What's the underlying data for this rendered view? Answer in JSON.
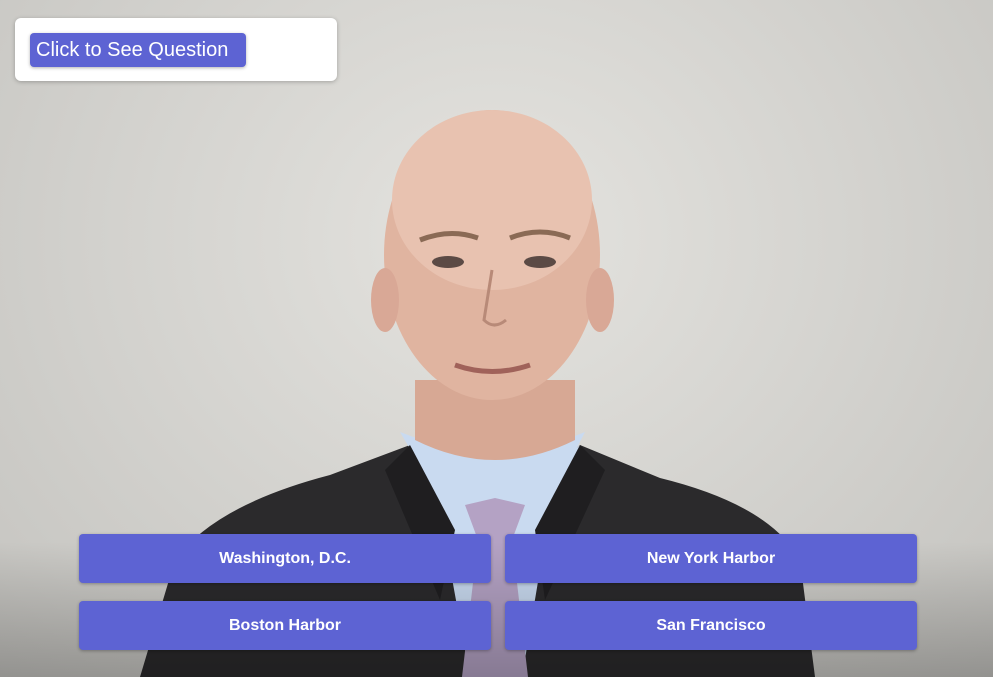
{
  "colors": {
    "accent": "#5d63d3",
    "card_background": "#ffffff",
    "wall": "#d6d5d1",
    "suit": "#2b2a2c",
    "shirt": "#c9daf0",
    "tie": "#b4a2c4",
    "skin": "#e0b4a0"
  },
  "question": {
    "button_label": "Click to See Question"
  },
  "answers": [
    {
      "label": "Washington, D.C."
    },
    {
      "label": "New York Harbor"
    },
    {
      "label": "Boston Harbor"
    },
    {
      "label": "San Francisco"
    }
  ],
  "video": {
    "subject": "presenter-video"
  }
}
